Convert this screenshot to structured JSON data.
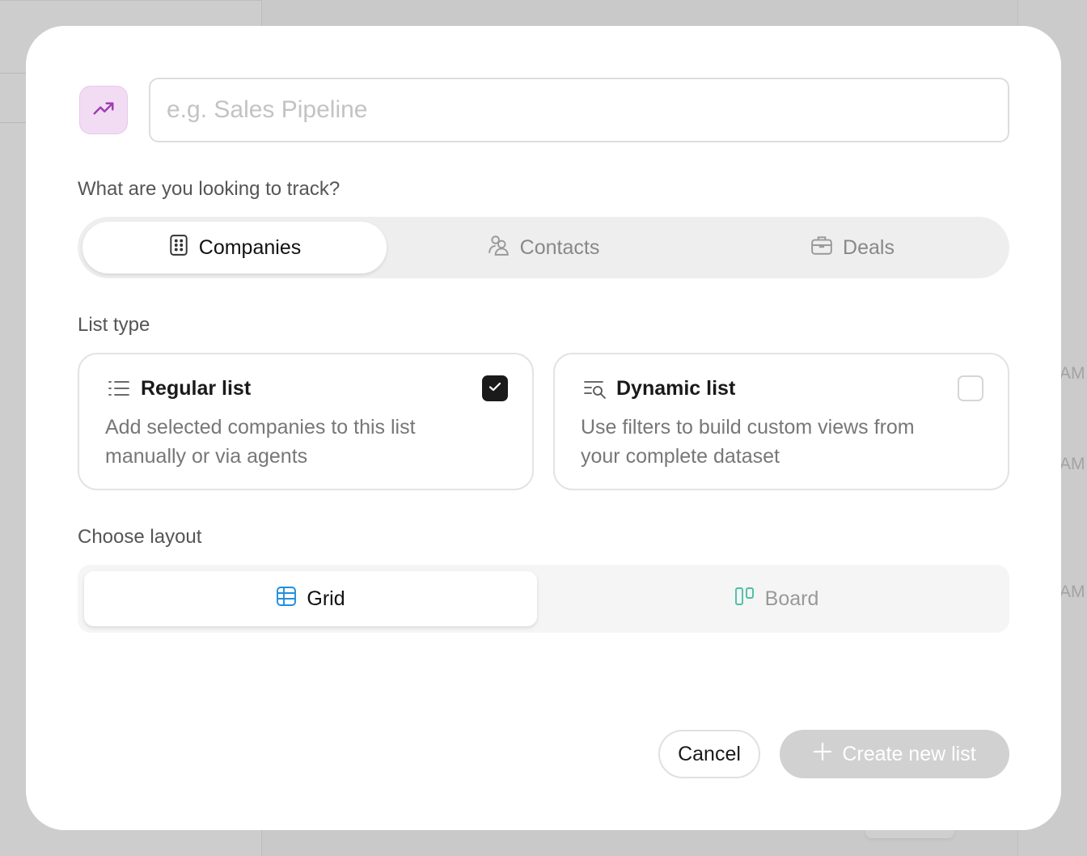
{
  "background": {
    "times": [
      "AM",
      "AM",
      "AM"
    ]
  },
  "modal": {
    "icon": "trending-up-icon",
    "name_input": {
      "placeholder": "e.g. Sales Pipeline",
      "value": ""
    },
    "track": {
      "label": "What are you looking to track?",
      "options": [
        {
          "label": "Companies",
          "icon": "building-icon",
          "selected": true
        },
        {
          "label": "Contacts",
          "icon": "users-icon",
          "selected": false
        },
        {
          "label": "Deals",
          "icon": "briefcase-icon",
          "selected": false
        }
      ]
    },
    "list_type": {
      "label": "List type",
      "options": [
        {
          "title": "Regular list",
          "description": "Add selected companies to this list manually or via agents",
          "icon": "list-icon",
          "checked": true
        },
        {
          "title": "Dynamic list",
          "description": "Use filters to build custom views from your complete dataset",
          "icon": "filter-search-icon",
          "checked": false
        }
      ]
    },
    "layout": {
      "label": "Choose layout",
      "options": [
        {
          "label": "Grid",
          "icon": "grid-icon",
          "selected": true
        },
        {
          "label": "Board",
          "icon": "board-icon",
          "selected": false
        }
      ]
    },
    "footer": {
      "cancel_label": "Cancel",
      "create_label": "Create new list"
    }
  },
  "colors": {
    "icon_tile_bg": "#f1dcf4",
    "icon_tile_fg": "#a23cb4",
    "grid_icon": "#1f8fe0",
    "board_icon": "#4bbfa6",
    "checkbox_checked": "#1a1a1a",
    "create_button_disabled": "#d1d1d1"
  }
}
